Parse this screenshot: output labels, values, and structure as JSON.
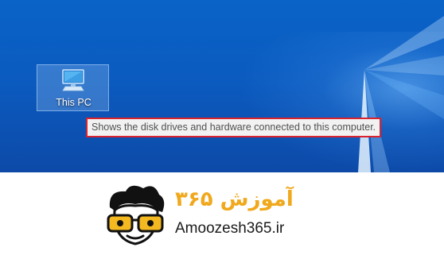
{
  "desktop": {
    "icon": {
      "label": "This PC",
      "icon_name": "computer-monitor-icon"
    },
    "tooltip": {
      "text": "Shows the disk drives and hardware connected to this computer.",
      "highlight_color": "#d9232f"
    },
    "wallpaper_colors": [
      "#0a63c7",
      "#0d4aa8"
    ]
  },
  "watermark": {
    "logo_text_fa": "آموزش ۳۶۵",
    "site": "Amoozesh365.ir",
    "accent": "#f0a81c"
  }
}
